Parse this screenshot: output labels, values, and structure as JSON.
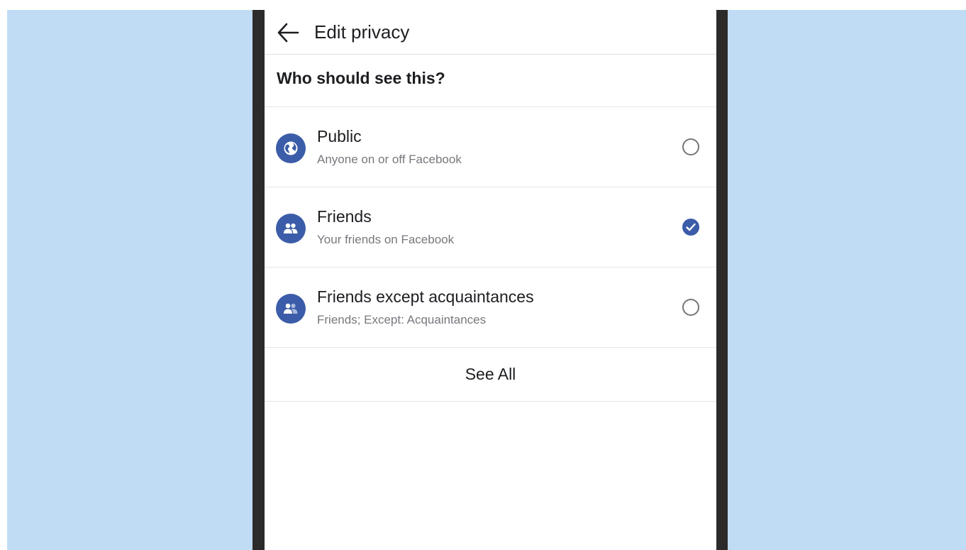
{
  "header": {
    "title": "Edit privacy",
    "back_icon": "arrow-left-icon"
  },
  "section": {
    "title": "Who should see this?"
  },
  "options": [
    {
      "title": "Public",
      "subtitle": "Anyone on or off Facebook",
      "icon": "globe-icon",
      "selected": false
    },
    {
      "title": "Friends",
      "subtitle": "Your friends on Facebook",
      "icon": "friends-icon",
      "selected": true
    },
    {
      "title": "Friends except acquaintances",
      "subtitle": "Friends; Except: Acquaintances",
      "icon": "friends-except-icon",
      "selected": false
    }
  ],
  "see_all": {
    "label": "See All"
  },
  "colors": {
    "accent": "#3b5ca8",
    "background": "#c0dcf5",
    "phone_frame": "#2b2b2b",
    "text_primary": "#1c1e21",
    "text_secondary": "#75787d"
  }
}
